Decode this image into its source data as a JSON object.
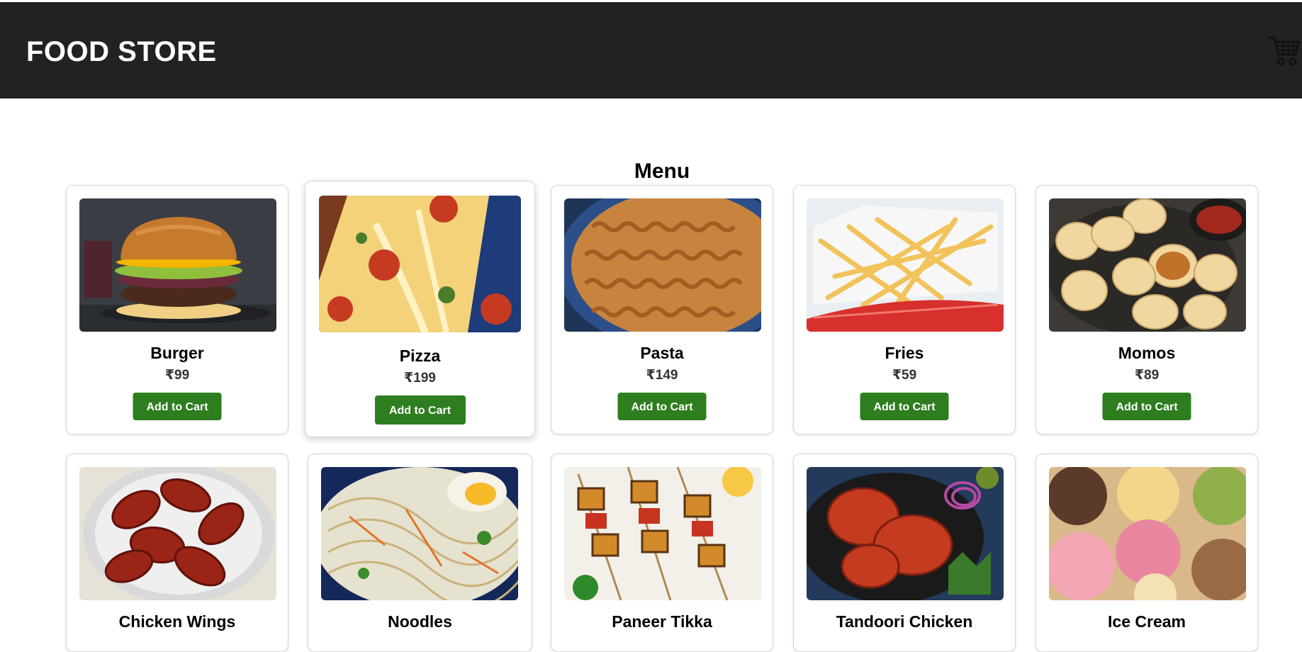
{
  "header": {
    "brand": "FOOD STORE",
    "cart_icon": "shopping-cart-icon"
  },
  "menu": {
    "title": "Menu",
    "add_to_cart_label": "Add to Cart",
    "items": [
      {
        "name": "Burger",
        "price": "₹99"
      },
      {
        "name": "Pizza",
        "price": "₹199"
      },
      {
        "name": "Pasta",
        "price": "₹149"
      },
      {
        "name": "Fries",
        "price": "₹59"
      },
      {
        "name": "Momos",
        "price": "₹89"
      },
      {
        "name": "Chicken Wings",
        "price": ""
      },
      {
        "name": "Noodles",
        "price": ""
      },
      {
        "name": "Paneer Tikka",
        "price": ""
      },
      {
        "name": "Tandoori Chicken",
        "price": ""
      },
      {
        "name": "Ice Cream",
        "price": ""
      }
    ]
  },
  "colors": {
    "header_bg": "#222222",
    "button_bg": "#2e7d1f",
    "button_text": "#ffffff"
  }
}
